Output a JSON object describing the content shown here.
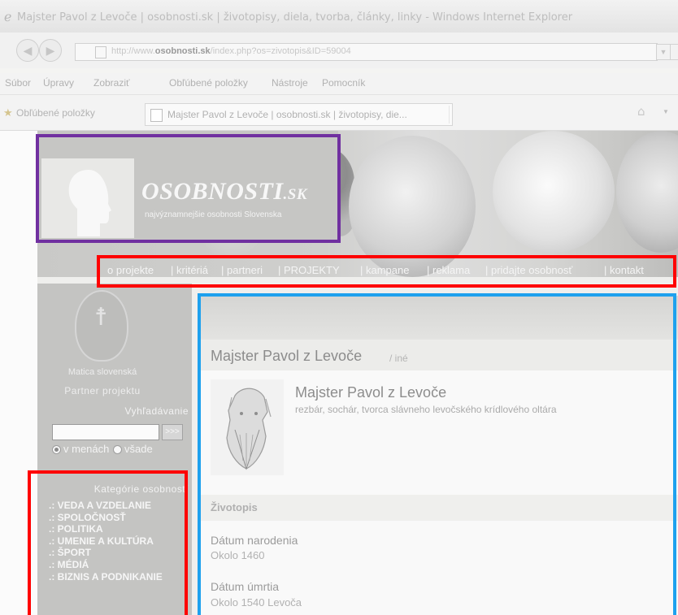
{
  "window": {
    "title": "Majster Pavol z Levoče | osobnosti.sk | životopisy, diela, tvorba, články, linky - Windows Internet Explorer"
  },
  "addressbar": {
    "url_prefix": "http://www.",
    "url_domain": "osobnosti.sk",
    "url_path": "/index.php?os=zivotopis&ID=59004"
  },
  "menu": {
    "items": [
      "Súbor",
      "Úpravy",
      "Zobraziť",
      "Obľúbené položky",
      "Nástroje",
      "Pomocník"
    ]
  },
  "favorites": {
    "label": "Obľúbené položky",
    "tab_title": "Majster Pavol z Levoče | osobnosti.sk | životopisy, die..."
  },
  "site": {
    "logo_main": "OSOBNOSTI",
    "logo_sk": ".SK",
    "tagline": "najvýznamnejšie osobnosti Slovenska",
    "nav": [
      "o projekte",
      "| kritériá",
      "| partneri",
      "| PROJEKTY",
      "| kampane",
      "| reklama",
      "| pridajte osobnosť",
      "| kontakt"
    ]
  },
  "sidebar": {
    "matica_label": "Matica slovenská",
    "partner_label": "Partner projektu",
    "search_title": "Vyhľadávanie",
    "search_value": "",
    "search_button": ">>>",
    "radio_names": "v menách",
    "radio_all": "všade",
    "categories_title": "Kategórie osobností",
    "categories": [
      ".: VEDA A VZDELANIE",
      ".: SPOLOČNOSŤ",
      ".: POLITIKA",
      ".: UMENIE A KULTÚRA",
      ".: ŠPORT",
      ".: MÉDIÁ",
      ".: BIZNIS A PODNIKANIE"
    ]
  },
  "content": {
    "heading": "Majster Pavol z Levoče",
    "heading_category": "/ iné",
    "name": "Majster Pavol z Levoče",
    "description": "rezbár, sochár, tvorca slávneho levočského krídlového oltára",
    "bio_title": "Životopis",
    "birth_label": "Dátum narodenia",
    "birth_value": "Okolo 1460",
    "death_label": "Dátum úmrtia",
    "death_value": "Okolo 1540 Levoča"
  },
  "colors": {
    "highlight_logo": "#7030a0",
    "highlight_nav": "#ff0000",
    "highlight_content": "#1ea1ee",
    "highlight_categories": "#ff0000"
  }
}
